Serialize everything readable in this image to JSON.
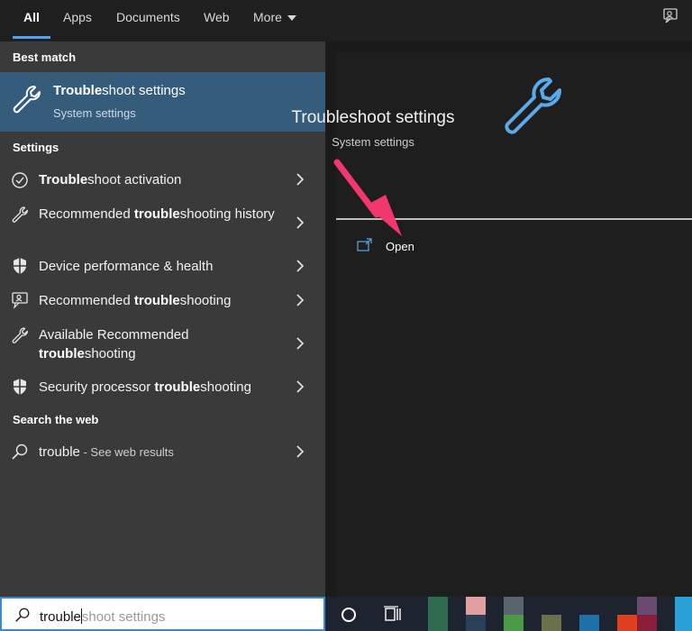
{
  "tabs": [
    {
      "label": "All",
      "active": true
    },
    {
      "label": "Apps"
    },
    {
      "label": "Documents"
    },
    {
      "label": "Web"
    },
    {
      "label": "More"
    }
  ],
  "sections": {
    "best_match": "Best match",
    "settings": "Settings",
    "search_web": "Search the web"
  },
  "best_match": {
    "title_bold": "Trouble",
    "title_rest": "shoot settings",
    "subtitle": "System settings",
    "icon": "wrench-icon"
  },
  "settings_items": [
    {
      "pre": "",
      "bold": "Trouble",
      "post": "shoot activation",
      "icon": "check-circle-icon"
    },
    {
      "pre": "Recommended ",
      "bold": "trouble",
      "post": "shooting history",
      "icon": "wrench-icon"
    },
    {
      "pre": "Device performance & health",
      "bold": "",
      "post": "",
      "icon": "shield-icon"
    },
    {
      "pre": "Recommended ",
      "bold": "trouble",
      "post": "shooting",
      "icon": "person-chat-icon"
    },
    {
      "pre": "Available Recommended ",
      "bold": "trouble",
      "post": "shooting",
      "icon": "wrench-icon"
    },
    {
      "pre": "Security processor ",
      "bold": "trouble",
      "post": "shooting",
      "icon": "shield-icon"
    }
  ],
  "web_item": {
    "query": "trouble",
    "hint": " - See web results",
    "icon": "search-icon"
  },
  "preview": {
    "title": "Troubleshoot settings",
    "subtitle": "System settings",
    "icon": "wrench-icon",
    "action_open": "Open",
    "action_icon": "open-window-icon"
  },
  "search": {
    "typed": "trouble",
    "suggestion": "shoot settings",
    "icon": "search-icon"
  },
  "colors": {
    "accent": "#4ea1f3",
    "best_match_bg": "#365c7c",
    "annotation_arrow": "#f2366e"
  },
  "taskbar": {
    "icons": [
      "cortana-circle-icon",
      "task-view-icon"
    ]
  }
}
